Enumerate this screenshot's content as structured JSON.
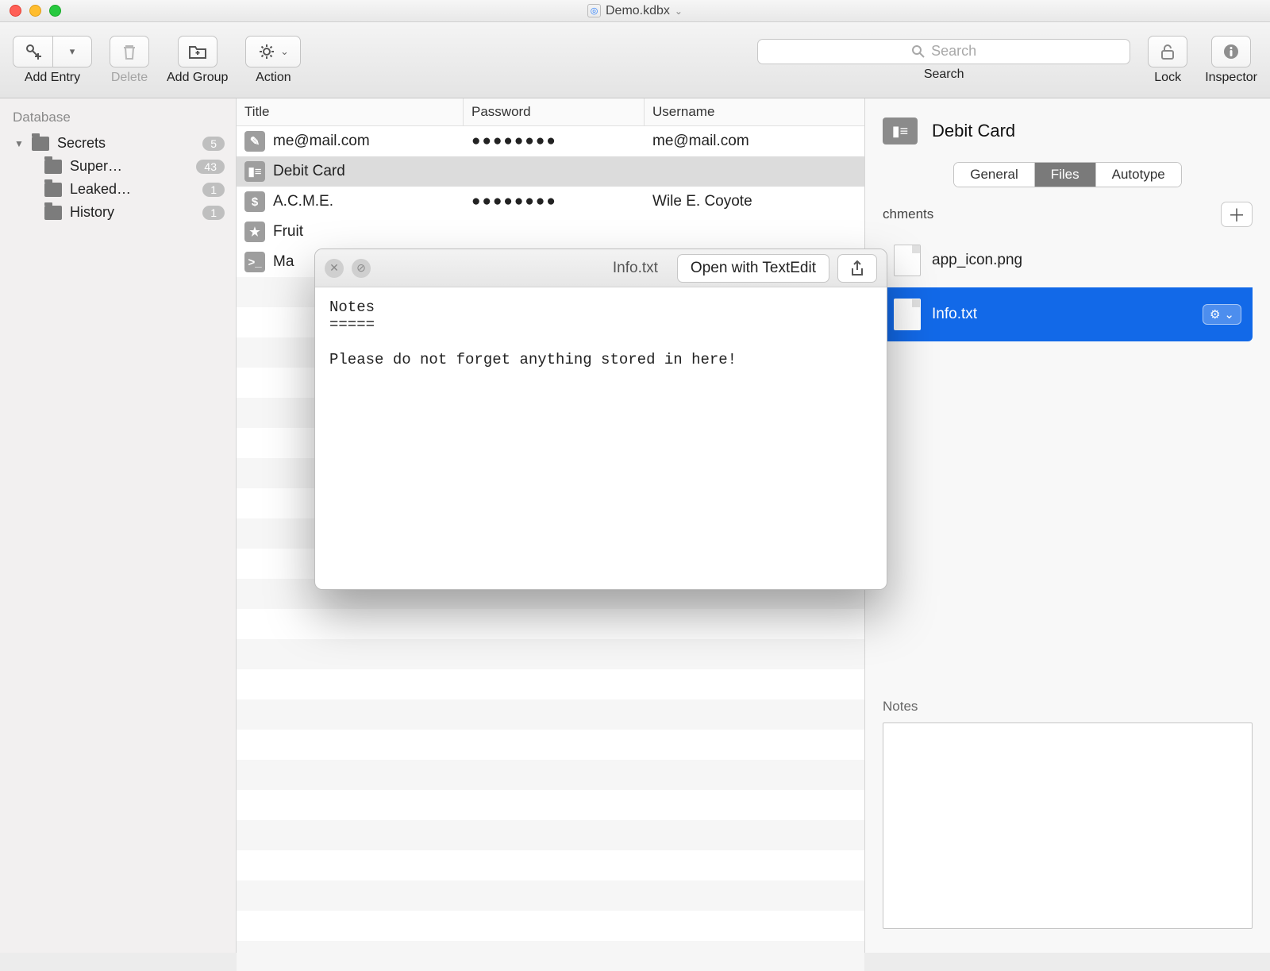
{
  "window": {
    "title": "Demo.kdbx"
  },
  "toolbar": {
    "add_entry": "Add Entry",
    "delete": "Delete",
    "add_group": "Add Group",
    "action": "Action",
    "search_placeholder": "Search",
    "search_label": "Search",
    "lock": "Lock",
    "inspector": "Inspector"
  },
  "sidebar": {
    "header": "Database",
    "root": {
      "label": "Secrets",
      "badge": "5"
    },
    "children": [
      {
        "label": "Super…",
        "badge": "43"
      },
      {
        "label": "Leaked…",
        "badge": "1"
      },
      {
        "label": "History",
        "badge": "1"
      }
    ]
  },
  "table": {
    "columns": {
      "title": "Title",
      "password": "Password",
      "username": "Username"
    },
    "rows": [
      {
        "icon": "pen",
        "title": "me@mail.com",
        "password": "●●●●●●●●",
        "username": "me@mail.com",
        "selected": false
      },
      {
        "icon": "card",
        "title": "Debit Card",
        "password": "",
        "username": "",
        "selected": true
      },
      {
        "icon": "dollar",
        "title": "A.C.M.E.",
        "password": "●●●●●●●●",
        "username": "Wile E. Coyote",
        "selected": false
      },
      {
        "icon": "star",
        "title": "Fruit",
        "password": "",
        "username": "",
        "selected": false
      },
      {
        "icon": "term",
        "title": "Ma",
        "password": "",
        "username": "",
        "selected": false
      }
    ]
  },
  "inspector": {
    "title": "Debit Card",
    "tabs": {
      "general": "General",
      "files": "Files",
      "autotype": "Autotype",
      "active": "files"
    },
    "attachments_label": "chments",
    "attachments": [
      {
        "name": "app_icon.png",
        "selected": false
      },
      {
        "name": "Info.txt",
        "selected": true
      }
    ],
    "notes_label": "Notes"
  },
  "popover": {
    "title": "Info.txt",
    "open_label": "Open with TextEdit",
    "body": "Notes\n=====\n\nPlease do not forget anything stored in here!"
  }
}
